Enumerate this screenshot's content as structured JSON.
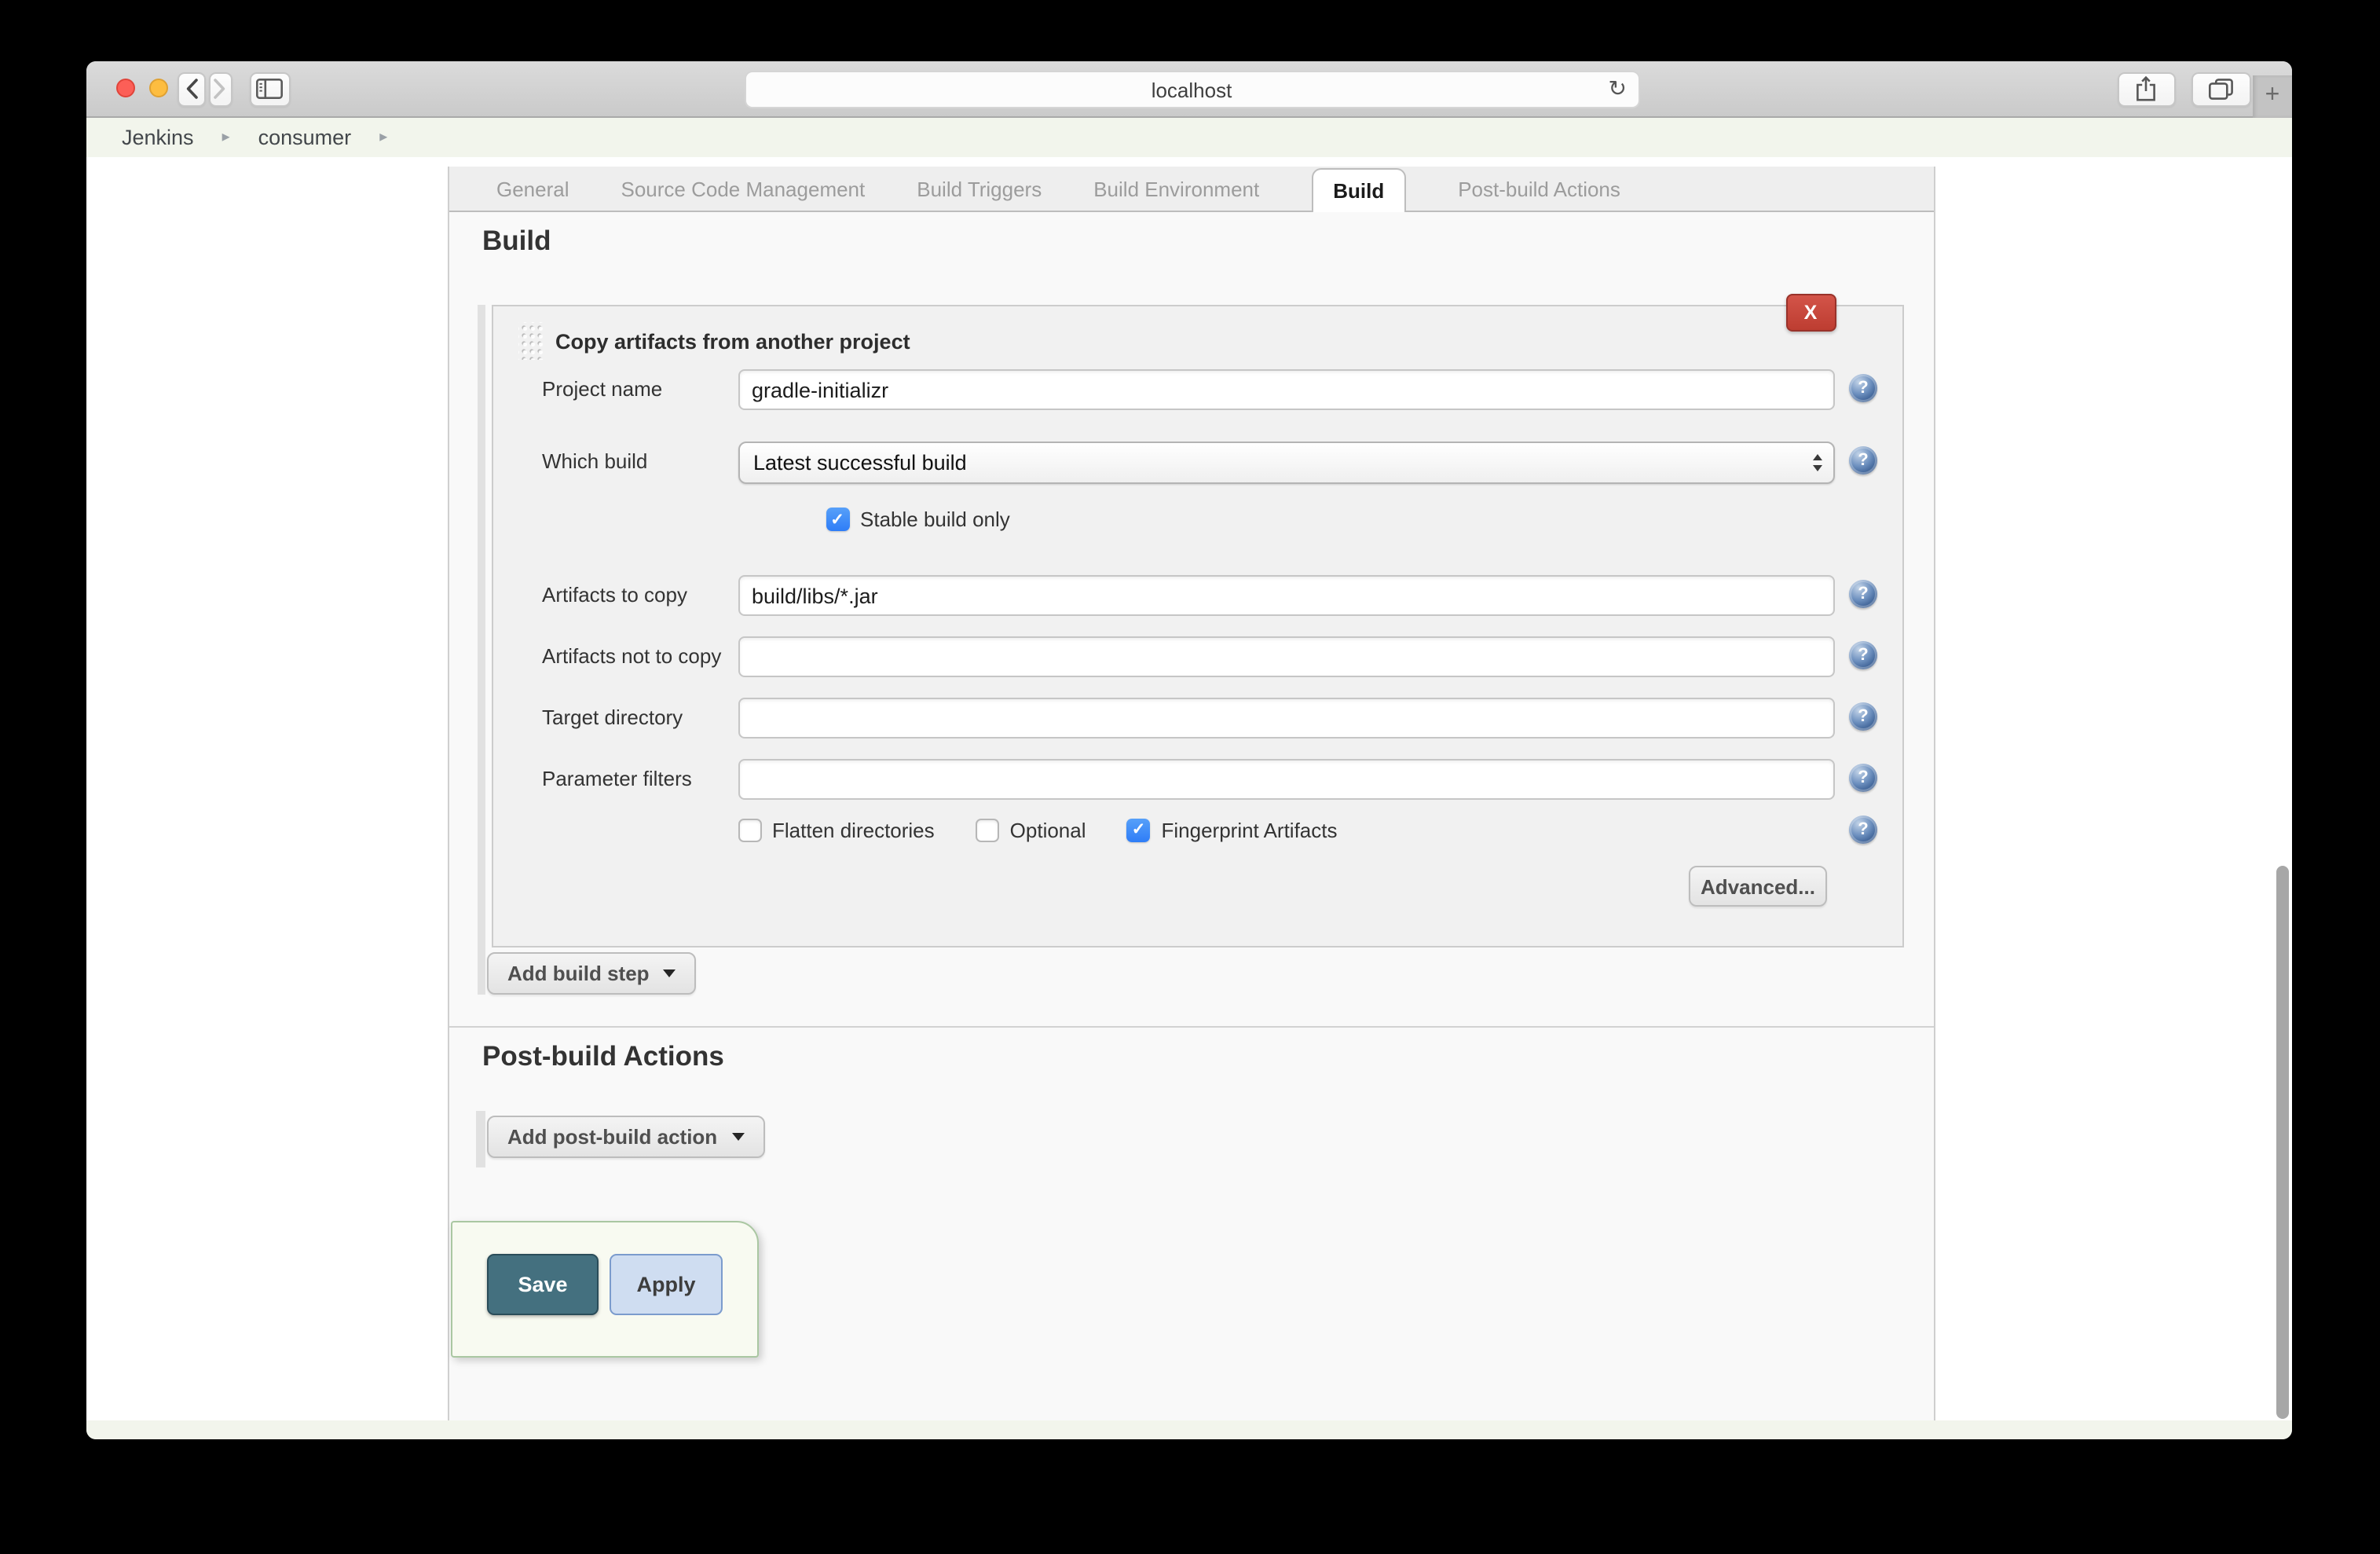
{
  "browser": {
    "url": "localhost",
    "new_tab_glyph": "+",
    "reload_glyph": "↻"
  },
  "breadcrumb": {
    "separator": "▸",
    "items": [
      "Jenkins",
      "consumer"
    ]
  },
  "tabs": {
    "active": "Build",
    "items": [
      "General",
      "Source Code Management",
      "Build Triggers",
      "Build Environment",
      "Build",
      "Post-build Actions"
    ]
  },
  "build": {
    "title": "Build",
    "add_step_label": "Add build step",
    "step": {
      "title": "Copy artifacts from another project",
      "delete_label": "X",
      "fields": [
        {
          "label": "Project name",
          "value": "gradle-initializr"
        },
        {
          "label": "Which build",
          "value": "Latest successful build"
        },
        {
          "label": "Artifacts to copy",
          "value": "build/libs/*.jar"
        },
        {
          "label": "Artifacts not to copy",
          "value": ""
        },
        {
          "label": "Target directory",
          "value": ""
        },
        {
          "label": "Parameter filters",
          "value": ""
        }
      ],
      "stable_checkbox": {
        "label": "Stable build only",
        "checked": true
      },
      "options": [
        {
          "label": "Flatten directories",
          "checked": false
        },
        {
          "label": "Optional",
          "checked": false
        },
        {
          "label": "Fingerprint Artifacts",
          "checked": true
        }
      ],
      "advanced_label": "Advanced..."
    }
  },
  "post_build": {
    "title": "Post-build Actions",
    "add_label": "Add post-build action"
  },
  "actions": {
    "save_label": "Save",
    "apply_label": "Apply"
  },
  "icons": {
    "help": "?",
    "check": "✓"
  },
  "colors": {
    "save_button": "#44707f",
    "apply_button": "#cfddf1",
    "delete_button": "#c64537",
    "checkbox_checked": "#2e7df7",
    "help_icon": "#35598e",
    "panel_background": "#f8faf1",
    "panel_border": "#aac7a2",
    "breadcrumb_bar": "#f2f5ec"
  }
}
